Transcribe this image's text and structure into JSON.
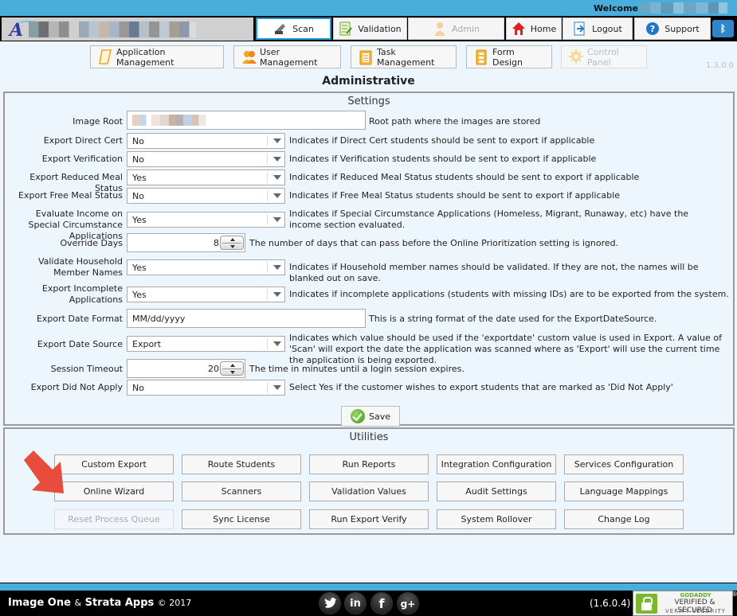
{
  "header": {
    "welcome_label": "Welcome",
    "nav": [
      {
        "label": "Scan",
        "icon": "scanner-icon",
        "active": true,
        "disabled": false
      },
      {
        "label": "Validation",
        "icon": "checklist-icon",
        "active": false,
        "disabled": false
      },
      {
        "label": "Admin",
        "icon": "user-icon",
        "active": false,
        "disabled": true
      },
      {
        "label": "Home",
        "icon": "home-icon",
        "active": false,
        "disabled": false
      },
      {
        "label": "Logout",
        "icon": "logout-icon",
        "active": false,
        "disabled": false
      },
      {
        "label": "Support",
        "icon": "help-icon",
        "active": false,
        "disabled": false
      }
    ],
    "extra_icon": "bluetooth-icon"
  },
  "toolbar": {
    "buttons": [
      {
        "label": "Application Management",
        "icon": "document-icon",
        "disabled": false
      },
      {
        "label": "User Management",
        "icon": "users-icon",
        "disabled": false
      },
      {
        "label": "Task Management",
        "icon": "clipboard-icon",
        "disabled": false
      },
      {
        "label": "Form Design",
        "icon": "form-icon",
        "disabled": false
      },
      {
        "label": "Control Panel",
        "icon": "gear-icon",
        "disabled": true
      }
    ],
    "version": "1.3.0.0"
  },
  "page_title": "Administrative",
  "settings": {
    "title": "Settings",
    "rows": [
      {
        "label": "Image Root",
        "type": "text",
        "value": "",
        "description": "Root path where the images are stored"
      },
      {
        "label": "Export Direct Cert",
        "type": "select",
        "value": "No",
        "description": "Indicates if Direct Cert students should be sent to export if applicable"
      },
      {
        "label": "Export Verification",
        "type": "select",
        "value": "No",
        "description": "Indicates if Verification students should be sent to export if applicable"
      },
      {
        "label": "Export Reduced Meal Status",
        "type": "select",
        "value": "Yes",
        "description": "Indicates if Reduced Meal Status students should be sent to export if applicable"
      },
      {
        "label": "Export Free Meal Status",
        "type": "select",
        "value": "No",
        "description": "Indicates if Free Meal Status students should be sent to export if applicable"
      },
      {
        "label": "Evaluate Income on Special Circumstance Applications",
        "type": "select",
        "value": "Yes",
        "description": "Indicates if Special Circumstance Applications (Homeless, Migrant, Runaway, etc) have the income section evaluated."
      },
      {
        "label": "Override Days",
        "type": "number",
        "value": "8",
        "description": "The number of days that can pass before the Online Prioritization setting is ignored."
      },
      {
        "label": "Validate Household Member Names",
        "type": "select",
        "value": "Yes",
        "description": "Indicates if Household member names should be validated. If they are not, the names will be blanked out on save."
      },
      {
        "label": "Export Incomplete Applications",
        "type": "select",
        "value": "Yes",
        "description": "Indicates if incomplete applications (students with missing IDs) are to be exported from the system."
      },
      {
        "label": "Export Date Format",
        "type": "text",
        "value": "MM/dd/yyyy",
        "description": "This is a string format of the date used for the ExportDateSource."
      },
      {
        "label": "Export Date Source",
        "type": "select",
        "value": "Export",
        "description": "Indicates which value should be used if the 'exportdate' custom value is used in Export. A value of 'Scan' will export the date the application was scanned where as 'Export' will use the current time the application is being exported."
      },
      {
        "label": "Session Timeout",
        "type": "number",
        "value": "20",
        "description": "The time in minutes until a login session expires."
      },
      {
        "label": "Export Did Not Apply",
        "type": "select",
        "value": "No",
        "description": "Select Yes if the customer wishes to export students that are marked as 'Did Not Apply'"
      }
    ],
    "save_label": "Save"
  },
  "utilities": {
    "title": "Utilities",
    "buttons": [
      {
        "label": "Custom Export",
        "disabled": false
      },
      {
        "label": "Route Students",
        "disabled": false
      },
      {
        "label": "Run Reports",
        "disabled": false
      },
      {
        "label": "Integration Configuration",
        "disabled": false
      },
      {
        "label": "Services Configuration",
        "disabled": false
      },
      {
        "label": "Online Wizard",
        "disabled": false
      },
      {
        "label": "Scanners",
        "disabled": false
      },
      {
        "label": "Validation Values",
        "disabled": false
      },
      {
        "label": "Audit Settings",
        "disabled": false
      },
      {
        "label": "Language Mappings",
        "disabled": false
      },
      {
        "label": "Reset Process Queue",
        "disabled": true
      },
      {
        "label": "Sync License",
        "disabled": false
      },
      {
        "label": "Run Export Verify",
        "disabled": false
      },
      {
        "label": "System Rollover",
        "disabled": false
      },
      {
        "label": "Change Log",
        "disabled": false
      }
    ]
  },
  "annotation": {
    "type": "arrow",
    "color": "#e84c3d",
    "points_to": "Online Wizard"
  },
  "footer": {
    "brand1": "Image One",
    "amp": "&",
    "brand2": "Strata Apps",
    "copyright": "© 2017",
    "social": [
      {
        "name": "twitter",
        "glyph": "t"
      },
      {
        "name": "linkedin",
        "glyph": "in"
      },
      {
        "name": "facebook",
        "glyph": "f"
      },
      {
        "name": "google-plus",
        "glyph": "g+"
      }
    ],
    "version": "(1.6.0.4)",
    "seal": {
      "line1": "GODADDY",
      "line2": "VERIFIED & SECURED",
      "line3": "VERIFY SECURITY",
      "reg": "®"
    }
  },
  "colors": {
    "accent": "#4aaedc",
    "background": "#eef6fd",
    "active_border": "#1c9ad6",
    "arrow": "#e84c3d"
  }
}
